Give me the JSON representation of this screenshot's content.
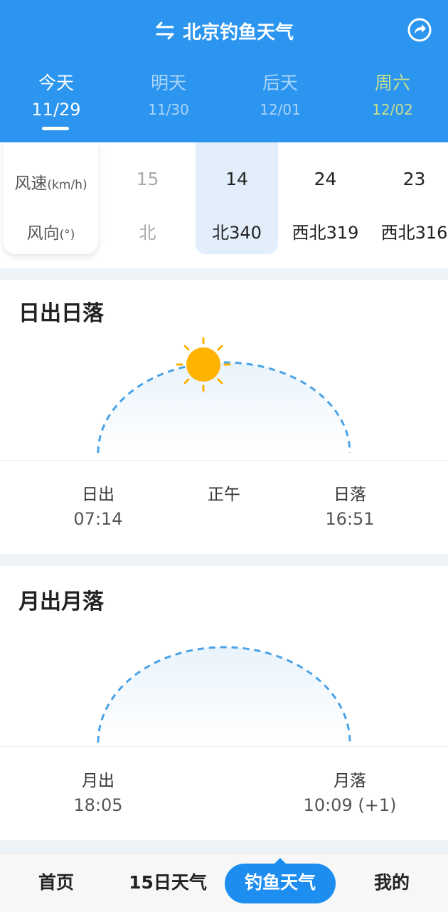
{
  "header": {
    "title": "北京钓鱼天气",
    "icons": {
      "swap": "swap-icon",
      "share": "share-icon"
    }
  },
  "day_tabs": [
    {
      "day": "今天",
      "date": "11/29"
    },
    {
      "day": "明天",
      "date": "11/30"
    },
    {
      "day": "后天",
      "date": "12/01"
    },
    {
      "day": "周六",
      "date": "12/02"
    }
  ],
  "wind": {
    "speed_label": "风速",
    "speed_unit": "(km/h)",
    "dir_label": "风向",
    "dir_unit": "(°)",
    "columns": [
      {
        "speed": "15",
        "dir": "北"
      },
      {
        "speed": "14",
        "dir": "北340"
      },
      {
        "speed": "24",
        "dir": "西北319"
      },
      {
        "speed": "23",
        "dir": "西北316"
      }
    ]
  },
  "sun": {
    "title": "日出日落",
    "rise_label": "日出",
    "rise_time": "07:14",
    "noon_label": "正午",
    "set_label": "日落",
    "set_time": "16:51"
  },
  "moon": {
    "title": "月出月落",
    "rise_label": "月出",
    "rise_time": "18:05",
    "set_label": "月落",
    "set_time": "10:09 (+1)"
  },
  "bottom_nav": [
    "首页",
    "15日天气",
    "钓鱼天气",
    "我的"
  ],
  "colors": {
    "primary": "#2b95ef",
    "weekend": "#c8df8d",
    "sun": "#ffb300",
    "arc": "#4aa3e8"
  }
}
